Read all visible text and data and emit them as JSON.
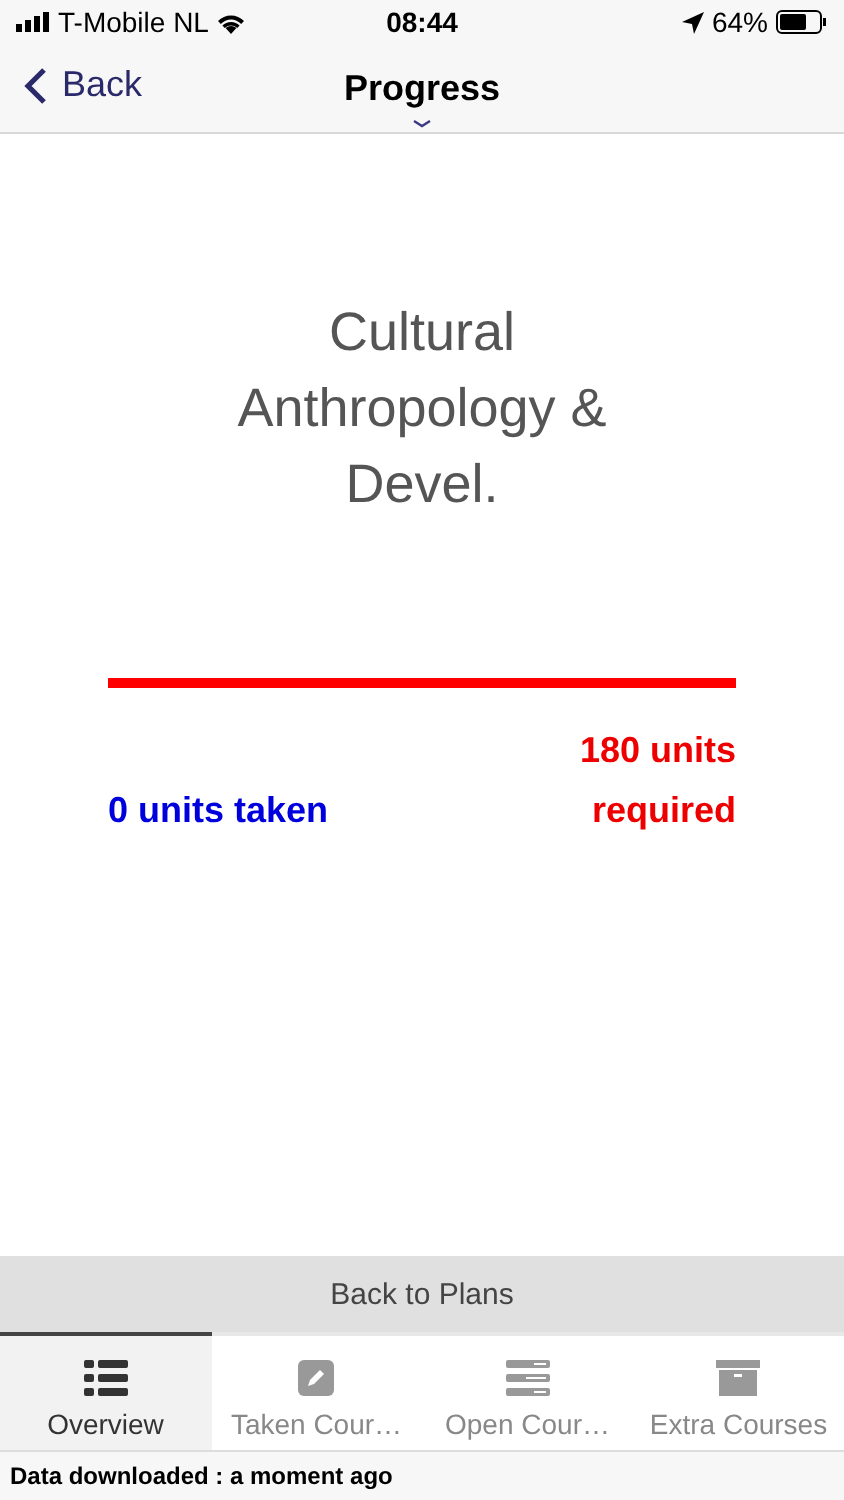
{
  "status_bar": {
    "carrier": "T-Mobile NL",
    "time": "08:44",
    "battery": "64%"
  },
  "nav": {
    "back": "Back",
    "title": "Progress"
  },
  "course": {
    "title": "Cultural Anthropology & Devel."
  },
  "progress": {
    "level": 0,
    "taken": "0 units taken",
    "required": "180 units required"
  },
  "back_button": "Back to Plans",
  "tabs": [
    {
      "label": "Overview",
      "kind": "list",
      "selected": true
    },
    {
      "label": "Taken Cour…",
      "kind": "pencil",
      "selected": false
    },
    {
      "label": "Open Cour…",
      "kind": "rows",
      "selected": false
    },
    {
      "label": "Extra Courses",
      "kind": "box",
      "selected": false
    }
  ],
  "footer": {
    "text": "Data downloaded : a moment ago"
  }
}
